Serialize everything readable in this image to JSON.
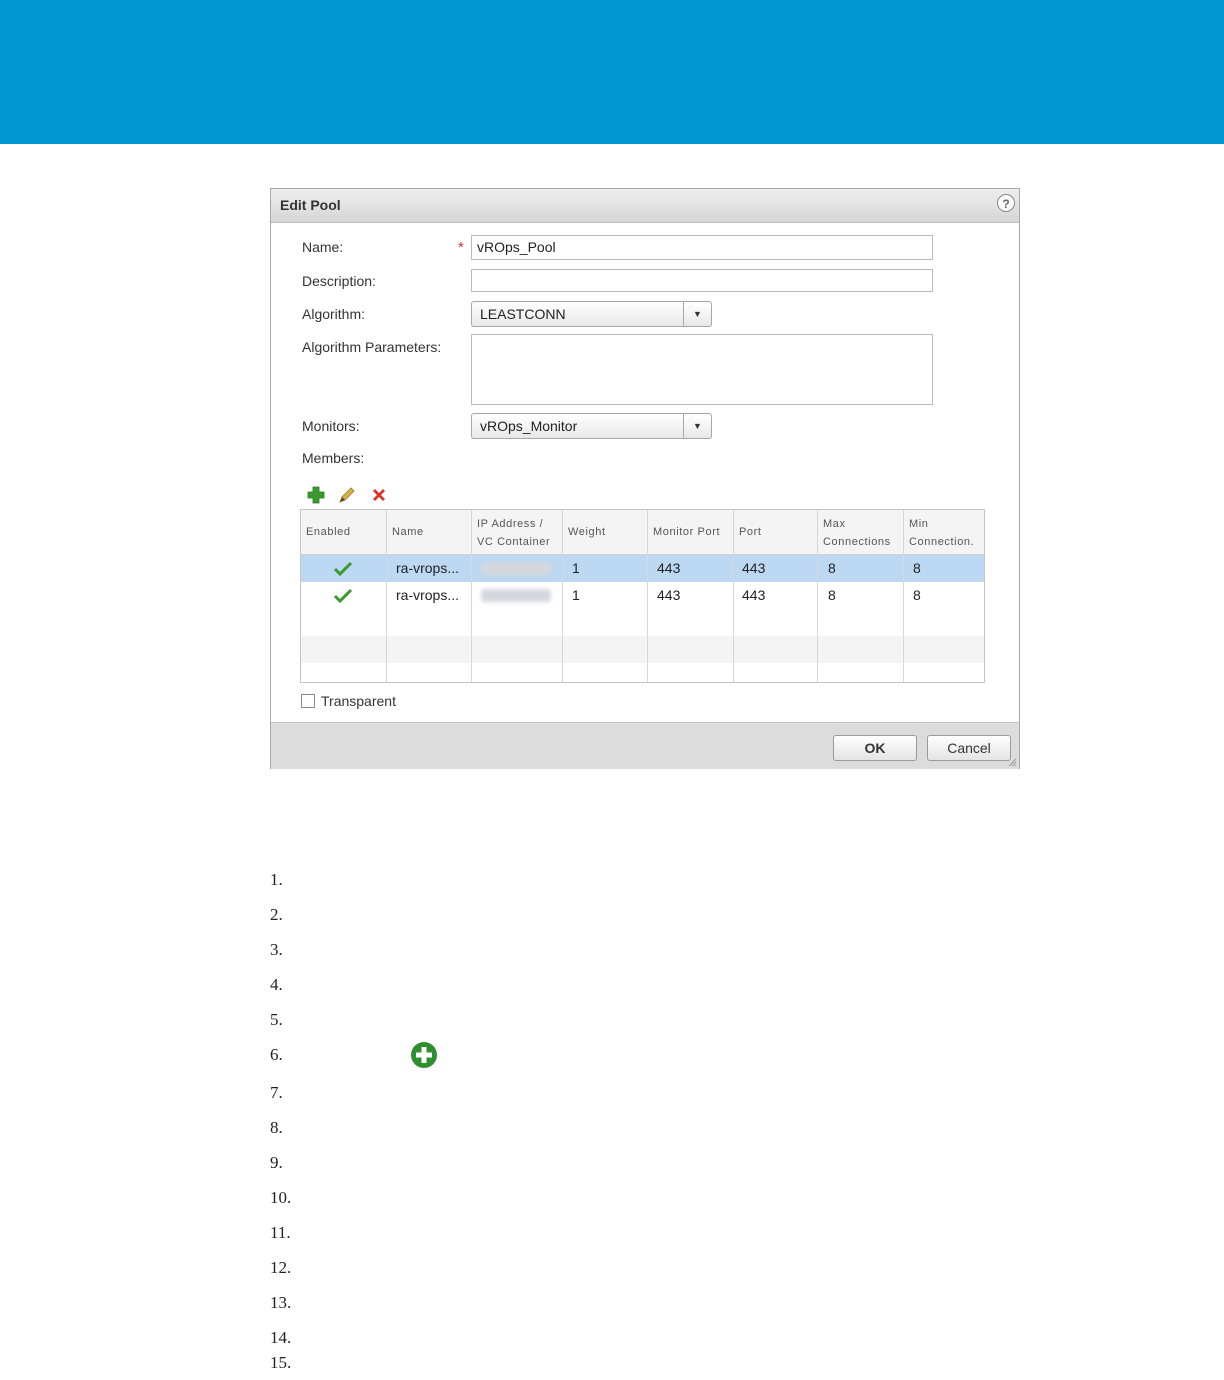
{
  "dialog": {
    "title": "Edit Pool",
    "help_glyph": "?"
  },
  "form": {
    "name_label": "Name:",
    "name_value": "vROps_Pool",
    "description_label": "Description:",
    "description_value": "",
    "algorithm_label": "Algorithm:",
    "algorithm_value": "LEASTCONN",
    "algorithm_params_label": "Algorithm Parameters:",
    "algorithm_params_value": "",
    "monitors_label": "Monitors:",
    "monitors_value": "vROps_Monitor",
    "members_label": "Members:",
    "transparent_label": "Transparent",
    "transparent_checked": false
  },
  "toolbar": {
    "icons": [
      "add-icon",
      "edit-icon",
      "delete-icon"
    ]
  },
  "members_table": {
    "headers": [
      "Enabled",
      "Name",
      "IP Address / VC Container",
      "Weight",
      "Monitor Port",
      "Port",
      "Max Connections",
      "Min Connection."
    ],
    "header_lines": [
      [
        "Enabled"
      ],
      [
        "Name"
      ],
      [
        "IP Address /",
        "VC Container"
      ],
      [
        "Weight"
      ],
      [
        "Monitor Port"
      ],
      [
        "Port"
      ],
      [
        "Max",
        "Connections"
      ],
      [
        "Min",
        "Connection."
      ]
    ],
    "rows": [
      {
        "enabled": true,
        "name": "ra-vrops...",
        "weight": "1",
        "monitor_port": "443",
        "port": "443",
        "max_connections": "8",
        "min_connections": "8",
        "selected": true
      },
      {
        "enabled": true,
        "name": "ra-vrops...",
        "weight": "1",
        "monitor_port": "443",
        "port": "443",
        "max_connections": "8",
        "min_connections": "8",
        "selected": false
      }
    ]
  },
  "buttons": {
    "ok": "OK",
    "cancel": "Cancel"
  },
  "steps": [
    "1.",
    "2.",
    "3.",
    "4.",
    "5.",
    "6.",
    "7.",
    "8.",
    "9.",
    "10.",
    "11.",
    "12.",
    "13.",
    "14.",
    "15."
  ],
  "colors": {
    "banner": "#0095d3",
    "selected_row": "#bcd8f2",
    "add_green": "#3a9a2e",
    "delete_red": "#d3352c"
  }
}
